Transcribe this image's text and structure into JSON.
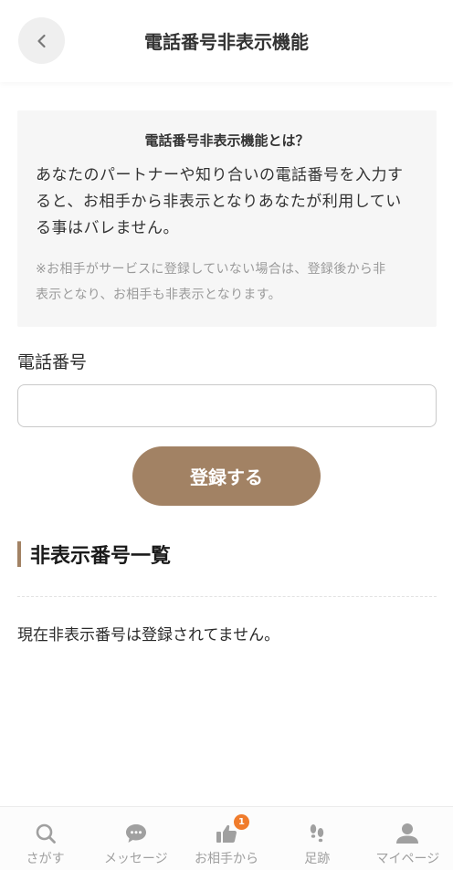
{
  "header": {
    "title": "電話番号非表示機能",
    "back_icon": "chevron-left-icon"
  },
  "info": {
    "title": "電話番号非表示機能とは？",
    "body_lines": [
      "あなたのパートナーや知り合いの電話番号を入力す",
      "ると、お相手から非表示となりあなたが利用してい",
      "る事はバレません。"
    ],
    "note_lines": [
      "※お相手がサービスに登録していない場合は、登録後から非",
      "表示となり、お相手も非表示となります。"
    ]
  },
  "form": {
    "phone_label": "電話番号",
    "phone_value": "",
    "phone_placeholder": "",
    "submit_label": "登録する"
  },
  "list": {
    "heading": "非表示番号一覧",
    "empty_message": "現在非表示番号は登録されてません。"
  },
  "nav": {
    "items": [
      {
        "label": "さがす",
        "icon": "search-icon"
      },
      {
        "label": "メッセージ",
        "icon": "chat-bubble-icon"
      },
      {
        "label": "お相手から",
        "icon": "thumbs-up-icon",
        "badge": "1"
      },
      {
        "label": "足跡",
        "icon": "footprints-icon"
      },
      {
        "label": "マイページ",
        "icon": "user-icon"
      }
    ]
  },
  "colors": {
    "accent": "#a28264",
    "badge": "#f07c2c",
    "nav_icon": "#a0a0a0"
  }
}
